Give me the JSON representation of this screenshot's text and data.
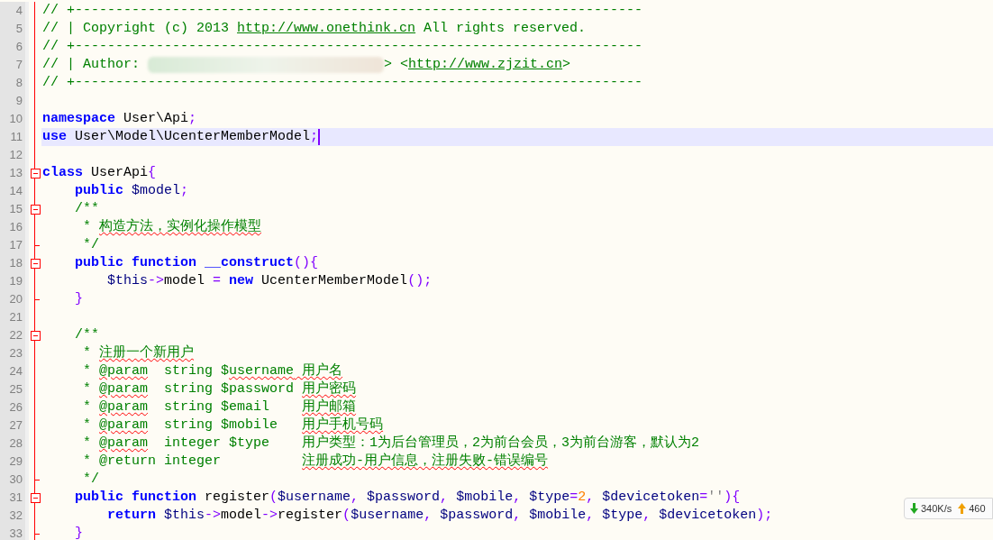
{
  "editor": {
    "lines": [
      {
        "number": "4",
        "fold_start": false,
        "fold_end": false,
        "current": false,
        "tokens": [
          {
            "text": "// +----------------------------------------------------------------------",
            "kind": "comment"
          }
        ]
      },
      {
        "number": "5",
        "fold_start": false,
        "fold_end": false,
        "current": false,
        "tokens": [
          {
            "text": "// | Copyright (c) 2013 ",
            "kind": "comment"
          },
          {
            "text": "http://www.onethink.cn",
            "kind": "link"
          },
          {
            "text": " All rights reserved.",
            "kind": "comment"
          }
        ]
      },
      {
        "number": "6",
        "fold_start": false,
        "fold_end": false,
        "current": false,
        "tokens": [
          {
            "text": "// +----------------------------------------------------------------------",
            "kind": "comment"
          }
        ]
      },
      {
        "number": "7",
        "fold_start": false,
        "fold_end": false,
        "current": false,
        "tokens": [
          {
            "text": "// | Author: ",
            "kind": "comment"
          },
          {
            "kind": "redacted"
          },
          {
            "text": "> <",
            "kind": "comment"
          },
          {
            "text": "http://www.zjzit.cn",
            "kind": "link"
          },
          {
            "text": ">",
            "kind": "comment"
          }
        ]
      },
      {
        "number": "8",
        "fold_start": false,
        "fold_end": false,
        "current": false,
        "tokens": [
          {
            "text": "// +----------------------------------------------------------------------",
            "kind": "comment"
          }
        ]
      },
      {
        "number": "9",
        "fold_start": false,
        "fold_end": false,
        "current": false
      },
      {
        "number": "10",
        "fold_start": false,
        "fold_end": false,
        "current": false,
        "tokens": [
          {
            "text": "namespace",
            "kind": "keyword"
          },
          {
            "text": " User\\Api",
            "kind": "plain"
          },
          {
            "text": ";",
            "kind": "op"
          }
        ]
      },
      {
        "number": "11",
        "fold_start": false,
        "fold_end": false,
        "current": true,
        "tokens": [
          {
            "text": "use",
            "kind": "keyword"
          },
          {
            "text": " User\\Model\\UcenterMemberModel",
            "kind": "plain"
          },
          {
            "text": ";",
            "kind": "op"
          }
        ]
      },
      {
        "number": "12",
        "fold_start": false,
        "fold_end": false,
        "current": false
      },
      {
        "number": "13",
        "fold_start": true,
        "fold_end": false,
        "current": false,
        "tokens": [
          {
            "text": "class",
            "kind": "keyword"
          },
          {
            "text": " UserApi",
            "kind": "plain"
          },
          {
            "text": "{",
            "kind": "op"
          }
        ]
      },
      {
        "number": "14",
        "fold_start": false,
        "fold_end": false,
        "current": false,
        "tokens": [
          {
            "text": "    public",
            "kind": "keyword"
          },
          {
            "text": " $model",
            "kind": "variable"
          },
          {
            "text": ";",
            "kind": "op"
          }
        ]
      },
      {
        "number": "15",
        "fold_start": true,
        "fold_end": false,
        "current": false,
        "tokens": [
          {
            "text": "    /**",
            "kind": "comment"
          }
        ]
      },
      {
        "number": "16",
        "fold_start": false,
        "fold_end": false,
        "current": false,
        "tokens": [
          {
            "text": "     * ",
            "kind": "comment"
          },
          {
            "text": "构造方法，实例化操作模型",
            "kind": "misspelled"
          }
        ]
      },
      {
        "number": "17",
        "fold_start": false,
        "fold_end": true,
        "current": false,
        "tokens": [
          {
            "text": "     */",
            "kind": "comment"
          }
        ]
      },
      {
        "number": "18",
        "fold_start": true,
        "fold_end": false,
        "current": false,
        "tokens": [
          {
            "text": "    public",
            "kind": "keyword"
          },
          {
            "text": " function",
            "kind": "keyword"
          },
          {
            "text": " __construct",
            "kind": "keyword"
          },
          {
            "text": "(){",
            "kind": "op"
          }
        ]
      },
      {
        "number": "19",
        "fold_start": false,
        "fold_end": false,
        "current": false,
        "tokens": [
          {
            "text": "        $this",
            "kind": "variable"
          },
          {
            "text": "->",
            "kind": "op"
          },
          {
            "text": "model ",
            "kind": "plain"
          },
          {
            "text": "=",
            "kind": "op"
          },
          {
            "text": " new",
            "kind": "keyword"
          },
          {
            "text": " UcenterMemberModel",
            "kind": "plain"
          },
          {
            "text": "();",
            "kind": "op"
          }
        ]
      },
      {
        "number": "20",
        "fold_start": false,
        "fold_end": true,
        "current": false,
        "tokens": [
          {
            "text": "    }",
            "kind": "op"
          }
        ]
      },
      {
        "number": "21",
        "fold_start": false,
        "fold_end": false,
        "current": false
      },
      {
        "number": "22",
        "fold_start": true,
        "fold_end": false,
        "current": false,
        "tokens": [
          {
            "text": "    /**",
            "kind": "comment"
          }
        ]
      },
      {
        "number": "23",
        "fold_start": false,
        "fold_end": false,
        "current": false,
        "tokens": [
          {
            "text": "     * ",
            "kind": "comment"
          },
          {
            "text": "注册一个新用户",
            "kind": "misspelled"
          }
        ]
      },
      {
        "number": "24",
        "fold_start": false,
        "fold_end": false,
        "current": false,
        "tokens": [
          {
            "text": "     * ",
            "kind": "comment"
          },
          {
            "text": "@param",
            "kind": "misspelled"
          },
          {
            "text": "  string $",
            "kind": "comment"
          },
          {
            "text": "username",
            "kind": "misspelled"
          },
          {
            "text": " 用户名",
            "kind": "misspelled"
          }
        ]
      },
      {
        "number": "25",
        "fold_start": false,
        "fold_end": false,
        "current": false,
        "tokens": [
          {
            "text": "     * ",
            "kind": "comment"
          },
          {
            "text": "@param",
            "kind": "misspelled"
          },
          {
            "text": "  string $password ",
            "kind": "comment"
          },
          {
            "text": "用户密码",
            "kind": "misspelled"
          }
        ]
      },
      {
        "number": "26",
        "fold_start": false,
        "fold_end": false,
        "current": false,
        "tokens": [
          {
            "text": "     * ",
            "kind": "comment"
          },
          {
            "text": "@param",
            "kind": "misspelled"
          },
          {
            "text": "  string $email    ",
            "kind": "comment"
          },
          {
            "text": "用户邮箱",
            "kind": "misspelled"
          }
        ]
      },
      {
        "number": "27",
        "fold_start": false,
        "fold_end": false,
        "current": false,
        "tokens": [
          {
            "text": "     * ",
            "kind": "comment"
          },
          {
            "text": "@param",
            "kind": "misspelled"
          },
          {
            "text": "  string $mobile   ",
            "kind": "comment"
          },
          {
            "text": "用户手机号码",
            "kind": "misspelled"
          }
        ]
      },
      {
        "number": "28",
        "fold_start": false,
        "fold_end": false,
        "current": false,
        "tokens": [
          {
            "text": "     * ",
            "kind": "comment"
          },
          {
            "text": "@param",
            "kind": "misspelled"
          },
          {
            "text": "  integer $type    ",
            "kind": "comment"
          },
          {
            "text": "用户类型：1为后台管理员，2为前台会员，3为前台游客，默认为2",
            "kind": "comment"
          }
        ]
      },
      {
        "number": "29",
        "fold_start": false,
        "fold_end": false,
        "current": false,
        "tokens": [
          {
            "text": "     * @return integer          ",
            "kind": "comment"
          },
          {
            "text": "注册成功-用户信息，注册失败-错误编号",
            "kind": "misspelled"
          }
        ]
      },
      {
        "number": "30",
        "fold_start": false,
        "fold_end": true,
        "current": false,
        "tokens": [
          {
            "text": "     */",
            "kind": "comment"
          }
        ]
      },
      {
        "number": "31",
        "fold_start": true,
        "fold_end": false,
        "current": false,
        "tokens": [
          {
            "text": "    public",
            "kind": "keyword"
          },
          {
            "text": " function",
            "kind": "keyword"
          },
          {
            "text": " register",
            "kind": "plain"
          },
          {
            "text": "(",
            "kind": "op"
          },
          {
            "text": "$username",
            "kind": "variable"
          },
          {
            "text": ", ",
            "kind": "op"
          },
          {
            "text": "$password",
            "kind": "variable"
          },
          {
            "text": ", ",
            "kind": "op"
          },
          {
            "text": "$mobile",
            "kind": "variable"
          },
          {
            "text": ", ",
            "kind": "op"
          },
          {
            "text": "$type",
            "kind": "variable"
          },
          {
            "text": "=",
            "kind": "op"
          },
          {
            "text": "2",
            "kind": "number"
          },
          {
            "text": ", ",
            "kind": "op"
          },
          {
            "text": "$devicetoken",
            "kind": "variable"
          },
          {
            "text": "=",
            "kind": "op"
          },
          {
            "text": "''",
            "kind": "string"
          },
          {
            "text": "){",
            "kind": "op"
          }
        ]
      },
      {
        "number": "32",
        "fold_start": false,
        "fold_end": false,
        "current": false,
        "tokens": [
          {
            "text": "        return",
            "kind": "keyword"
          },
          {
            "text": " $this",
            "kind": "variable"
          },
          {
            "text": "->",
            "kind": "op"
          },
          {
            "text": "model",
            "kind": "plain"
          },
          {
            "text": "->",
            "kind": "op"
          },
          {
            "text": "register",
            "kind": "plain"
          },
          {
            "text": "(",
            "kind": "op"
          },
          {
            "text": "$username",
            "kind": "variable"
          },
          {
            "text": ", ",
            "kind": "op"
          },
          {
            "text": "$password",
            "kind": "variable"
          },
          {
            "text": ", ",
            "kind": "op"
          },
          {
            "text": "$mobile",
            "kind": "variable"
          },
          {
            "text": ", ",
            "kind": "op"
          },
          {
            "text": "$type",
            "kind": "variable"
          },
          {
            "text": ", ",
            "kind": "op"
          },
          {
            "text": "$devicetoken",
            "kind": "variable"
          },
          {
            "text": ");",
            "kind": "op"
          }
        ]
      },
      {
        "number": "33",
        "fold_start": false,
        "fold_end": true,
        "current": false,
        "tokens": [
          {
            "text": "    }",
            "kind": "op"
          }
        ]
      }
    ]
  },
  "network_widget": {
    "download": "340K/s",
    "upload": "460"
  }
}
